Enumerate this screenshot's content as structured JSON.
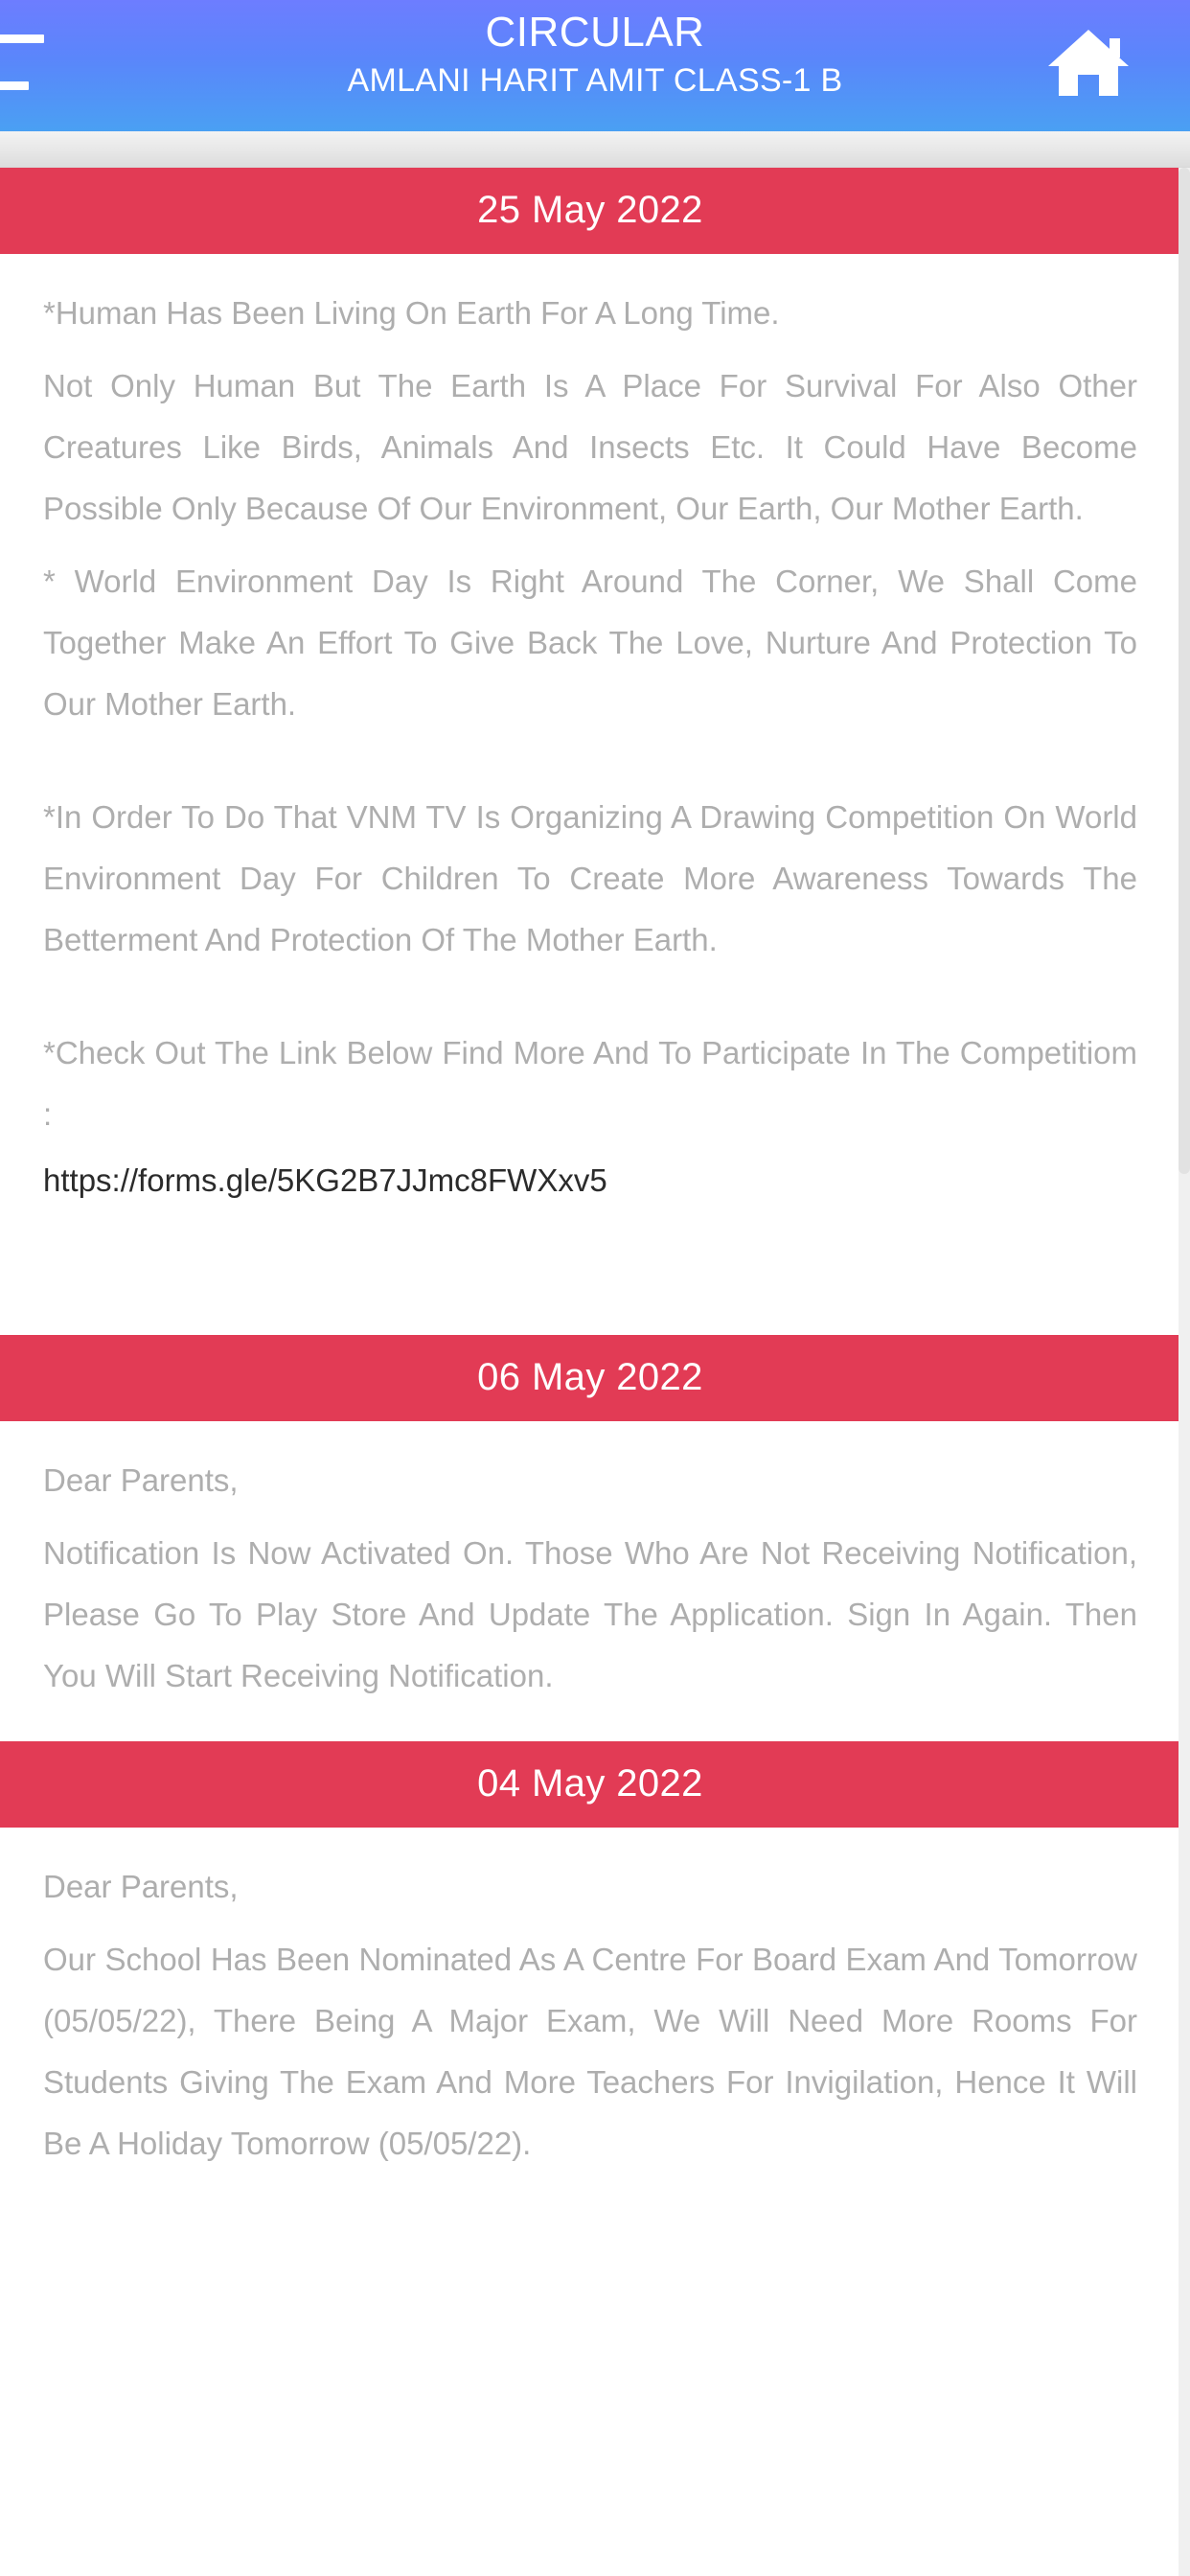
{
  "appbar": {
    "title": "CIRCULAR",
    "subtitle": "AMLANI HARIT AMIT CLASS-1 B",
    "menu_icon": "hamburger-menu-icon",
    "home_icon": "home-icon",
    "gradient_top": "#6d7dff",
    "gradient_bottom": "#4aa0f3"
  },
  "theme": {
    "banner_color": "#e23b55",
    "body_text_color": "#aeaeae",
    "link_text_color": "#2b2b2b",
    "page_background": "#ffffff"
  },
  "circulars": [
    {
      "date": "25 May 2022",
      "paragraphs": [
        "*Human Has Been Living On Earth For A Long Time.",
        "Not Only Human But The Earth Is A Place For Survival For Also Other Creatures Like Birds, Animals And Insects Etc. It Could Have Become Possible Only Because Of Our Environment, Our Earth, Our Mother Earth.",
        "* World Environment Day Is Right Around The Corner, We Shall Come Together Make An Effort To Give Back The Love, Nurture And Protection To Our Mother Earth.",
        "*In Order To Do That VNM TV Is Organizing A Drawing Competition On World Environment Day For Children To Create More Awareness Towards The Betterment And Protection Of The Mother Earth.",
        "*Check Out The Link Below Find More And To Participate In The Competitiom :"
      ],
      "link": "https://forms.gle/5KG2B7JJmc8FWXxv5"
    },
    {
      "date": "06 May 2022",
      "paragraphs": [
        "Dear Parents,",
        "Notification Is Now Activated On.  Those Who Are Not Receiving Notification, Please Go To Play Store And Update The Application. Sign In Again. Then You Will Start Receiving Notification."
      ]
    },
    {
      "date": "04 May 2022",
      "paragraphs": [
        "Dear Parents,",
        "Our School Has Been Nominated As A Centre For Board Exam And Tomorrow (05/05/22), There Being A Major Exam, We Will Need More Rooms For Students Giving The Exam And More Teachers For Invigilation, Hence It Will Be A Holiday Tomorrow (05/05/22)."
      ]
    }
  ]
}
